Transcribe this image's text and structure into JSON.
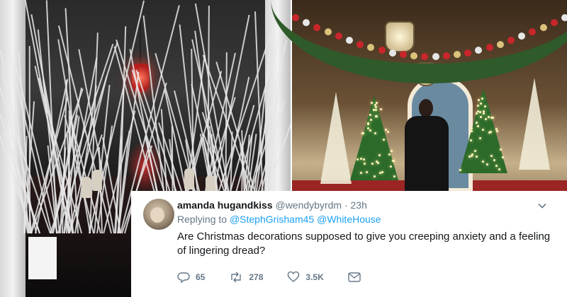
{
  "photos": {
    "left": {
      "subject": "dark-hallway-with-white-branches"
    },
    "right": {
      "subject": "lit-hallway-with-christmas-trees"
    }
  },
  "tweet": {
    "display_name": "amanda hugandkiss",
    "handle": "@wendybyrdm",
    "separator": "·",
    "time": "23h",
    "replying_prefix": "Replying to",
    "replying_to": [
      "@StephGrisham45",
      "@WhiteHouse"
    ],
    "text": "Are Christmas decorations supposed to give you creeping anxiety and a feeling of lingering dread?",
    "actions": {
      "reply": {
        "icon": "reply-icon",
        "count": "65"
      },
      "retweet": {
        "icon": "retweet-icon",
        "count": "278"
      },
      "like": {
        "icon": "heart-icon",
        "count": "3.5K"
      },
      "dm": {
        "icon": "envelope-icon"
      }
    },
    "menu_icon": "chevron-down-icon"
  },
  "colors": {
    "link": "#1da1f2",
    "secondary_text": "#657786",
    "primary_text": "#14171a",
    "card_bg": "#ffffff"
  }
}
